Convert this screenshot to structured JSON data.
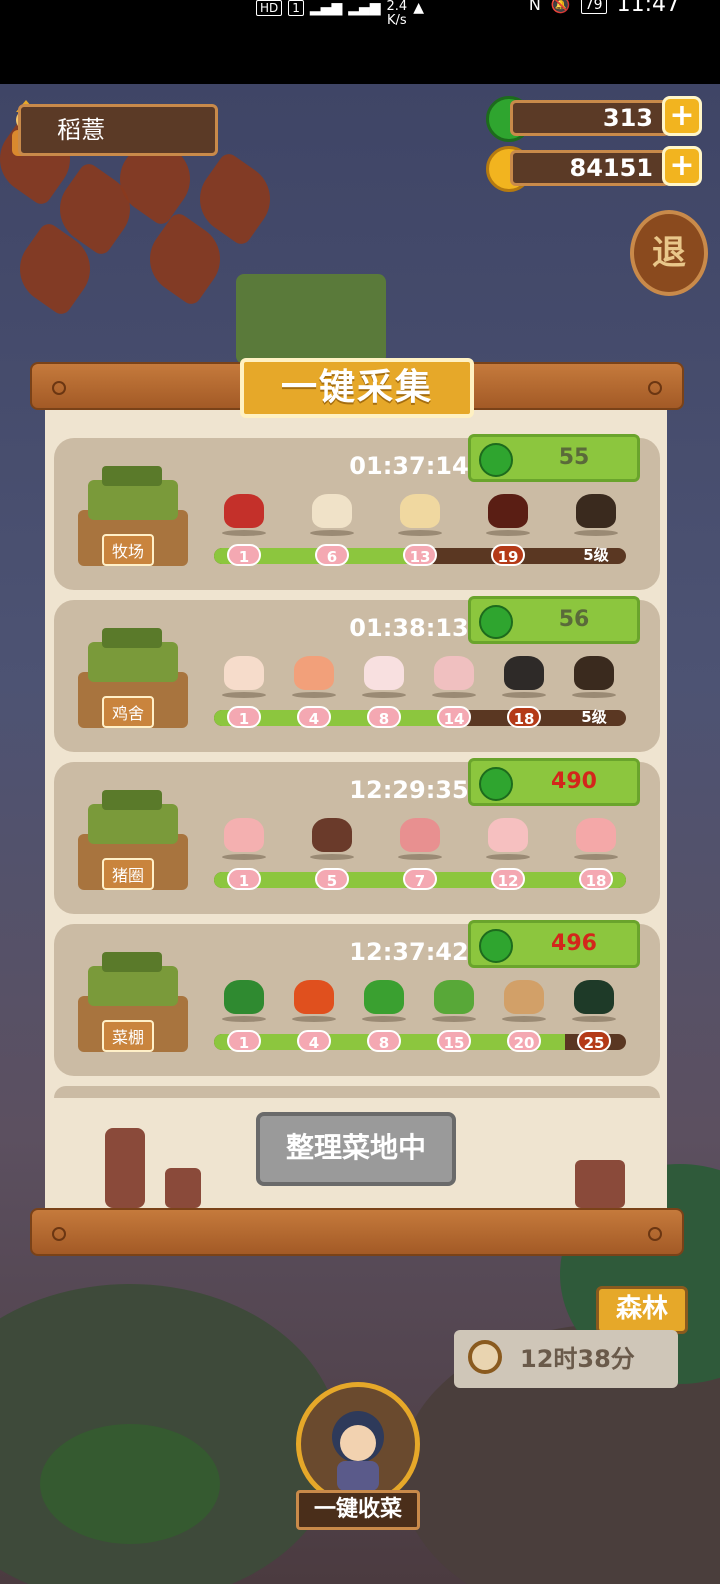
{
  "status_bar": {
    "hd_badge": "HD",
    "sim_badge": "1",
    "net_speed_top": "2.4",
    "net_speed_unit": "K/s",
    "battery": "79",
    "time": "11:47"
  },
  "hud": {
    "player_name": "稻薏",
    "gems": "313",
    "coins": "84151",
    "plus_label": "+",
    "exit_label": "退"
  },
  "panel": {
    "title": "一键采集",
    "cards": [
      {
        "tag": "牧场",
        "timer": "01:37:14",
        "cost": "55",
        "cost_highlight": false,
        "levels": [
          "1",
          "6",
          "13",
          "19",
          "5级"
        ],
        "items": [
          "meat",
          "milk-jar",
          "bread",
          "chocolate",
          "locked"
        ]
      },
      {
        "tag": "鸡舍",
        "timer": "01:38:13",
        "cost": "56",
        "cost_highlight": false,
        "levels": [
          "1",
          "4",
          "8",
          "14",
          "18",
          "5级"
        ],
        "items": [
          "egg",
          "chicken-breast",
          "chicken",
          "rooster",
          "black-egg",
          "locked"
        ]
      },
      {
        "tag": "猪圈",
        "timer": "12:29:35",
        "cost": "490",
        "cost_highlight": true,
        "levels": [
          "1",
          "5",
          "7",
          "12",
          "18"
        ],
        "items": [
          "bacon",
          "pork-bowl",
          "ham",
          "pork-slice",
          "pork-leg"
        ]
      },
      {
        "tag": "菜棚",
        "timer": "12:37:42",
        "cost": "496",
        "cost_highlight": true,
        "levels": [
          "1",
          "4",
          "8",
          "15",
          "20",
          "25"
        ],
        "items": [
          "cabbage",
          "tomato",
          "pepper",
          "cucumber",
          "box",
          "radish"
        ]
      }
    ],
    "tidy_button": "整理菜地中"
  },
  "scene": {
    "forest_sign": "森林",
    "forest_timer": "12时38分",
    "harvest_button": "一键收菜"
  },
  "colors": {
    "green_progress": "#8cc63e",
    "gold": "#e6a829",
    "wood": "#c57a3c",
    "red_cost": "#d3261b"
  }
}
